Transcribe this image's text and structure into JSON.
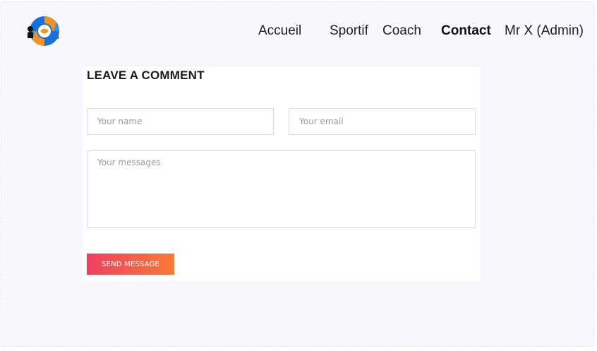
{
  "header": {
    "logo_icon": "people-circle-logo-icon",
    "nav": [
      {
        "label": "Accueil",
        "active": false
      },
      {
        "label": "Sportif",
        "active": false
      },
      {
        "label": "Coach",
        "active": false
      },
      {
        "label": "Contact",
        "active": true
      },
      {
        "label": "Mr X (Admin)",
        "active": false
      }
    ]
  },
  "comment_form": {
    "title": "LEAVE A COMMENT",
    "name_placeholder": "Your name",
    "email_placeholder": "Your email",
    "message_placeholder": "Your messages",
    "send_label": "SEND MESSAGE"
  },
  "colors": {
    "background": "#f8f7fe",
    "button_gradient_start": "#ee3f60",
    "button_gradient_end": "#fa7a37",
    "logo_blue": "#1a6fd8",
    "logo_orange": "#f39220",
    "logo_dark": "#111111"
  }
}
